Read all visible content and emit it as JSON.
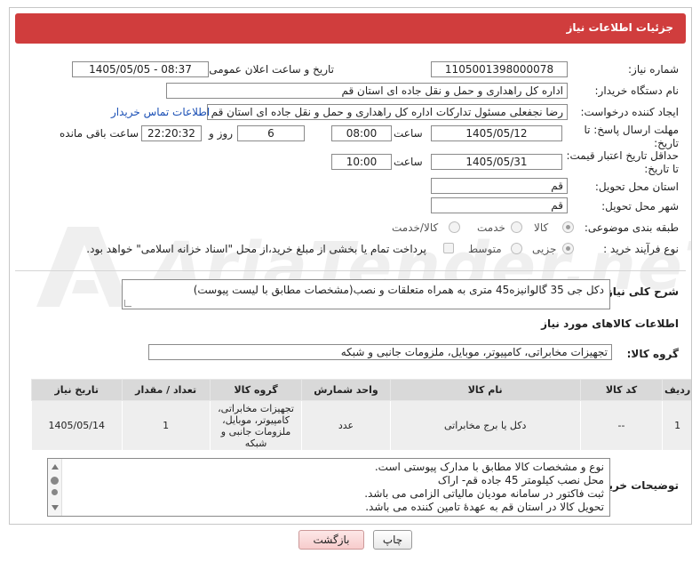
{
  "header": {
    "title": "جزئیات اطلاعات نیاز"
  },
  "fields": {
    "need_number": {
      "label": "شماره نیاز:",
      "value": "1105001398000078"
    },
    "announce_datetime": {
      "label": "تاریخ و ساعت اعلان عمومی:",
      "value": "1405/05/05 - 08:37"
    },
    "buyer_org": {
      "label": "نام دستگاه خریدار:",
      "value": "اداره کل راهداری و حمل و نقل جاده ای استان قم"
    },
    "requester": {
      "label": "ایجاد کننده درخواست:",
      "value": "رضا  نجفعلی مسئول تدارکات اداره کل راهداری و حمل و نقل جاده ای استان قم",
      "contact_link": "اطلاعات تماس خریدار"
    },
    "reply_deadline": {
      "label_line1": "مهلت ارسال پاسخ: تا",
      "label_line2": "تاریخ:",
      "date": "1405/05/12",
      "time_label": "ساعت",
      "time": "08:00",
      "days": "6",
      "days_label": "روز و",
      "remaining": "22:20:32",
      "remaining_label": "ساعت باقی مانده"
    },
    "price_validity": {
      "label_line1": "حداقل تاریخ اعتبار قیمت:",
      "label_line2": "تا تاریخ:",
      "date": "1405/05/31",
      "time_label": "ساعت",
      "time": "10:00"
    },
    "delivery_province": {
      "label": "استان محل تحویل:",
      "value": "قم"
    },
    "delivery_city": {
      "label": "شهر محل تحویل:",
      "value": "قم"
    },
    "category": {
      "label": "طبقه بندی موضوعی:",
      "options": [
        "کالا",
        "خدمت",
        "کالا/خدمت"
      ],
      "selected": "کالا"
    },
    "purchase_type": {
      "label": "نوع فرآیند خرید :",
      "options": [
        "جزیی",
        "متوسط"
      ],
      "selected": "جزیی",
      "payment_note": "پرداخت تمام یا بخشی از مبلغ خرید،از محل \"اسناد خزانه اسلامی\" خواهد بود."
    }
  },
  "description": {
    "label": "شرح کلی نیاز:",
    "value": "دکل جی 35 گالوانیزه45 متری به همراه متعلقات و نصب(مشخصات مطابق با لیست پیوست)"
  },
  "goods_info": {
    "title": "اطلاعات کالاهای مورد نیاز",
    "group_label": "گروه کالا:",
    "group_value": "تجهیزات مخابراتی، کامپیوتر، موبایل، ملزومات جانبی و شبکه"
  },
  "table": {
    "headers": [
      "ردیف",
      "کد کالا",
      "نام کالا",
      "واحد شمارش",
      "گروه کالا",
      "تعداد / مقدار",
      "تاریخ نیاز"
    ],
    "rows": [
      {
        "row": "1",
        "code": "--",
        "name": "دکل یا برج مخابراتی",
        "unit": "عدد",
        "group_lines": [
          "تجهیزات مخابراتی،",
          "کامپیوتر، موبایل،",
          "ملزومات جانبی و",
          "شبکه"
        ],
        "qty": "1",
        "date": "1405/05/14"
      }
    ]
  },
  "buyer_notes": {
    "label": "توضیحات خریدار:",
    "lines": [
      "نوع و مشخصات کالا مطابق با مدارک پیوستی است.",
      "محل نصب کیلومتر 45 جاده قم- اراک",
      "ثبت فاکتور در سامانه مودیان مالیاتی الزامی می باشد.",
      "تحویل کالا در استان قم به عهدهٔ تامین کننده می باشد."
    ]
  },
  "buttons": {
    "print": "چاپ",
    "back": "بازگشت"
  },
  "watermark": {
    "text": "AriaTender.neT"
  }
}
